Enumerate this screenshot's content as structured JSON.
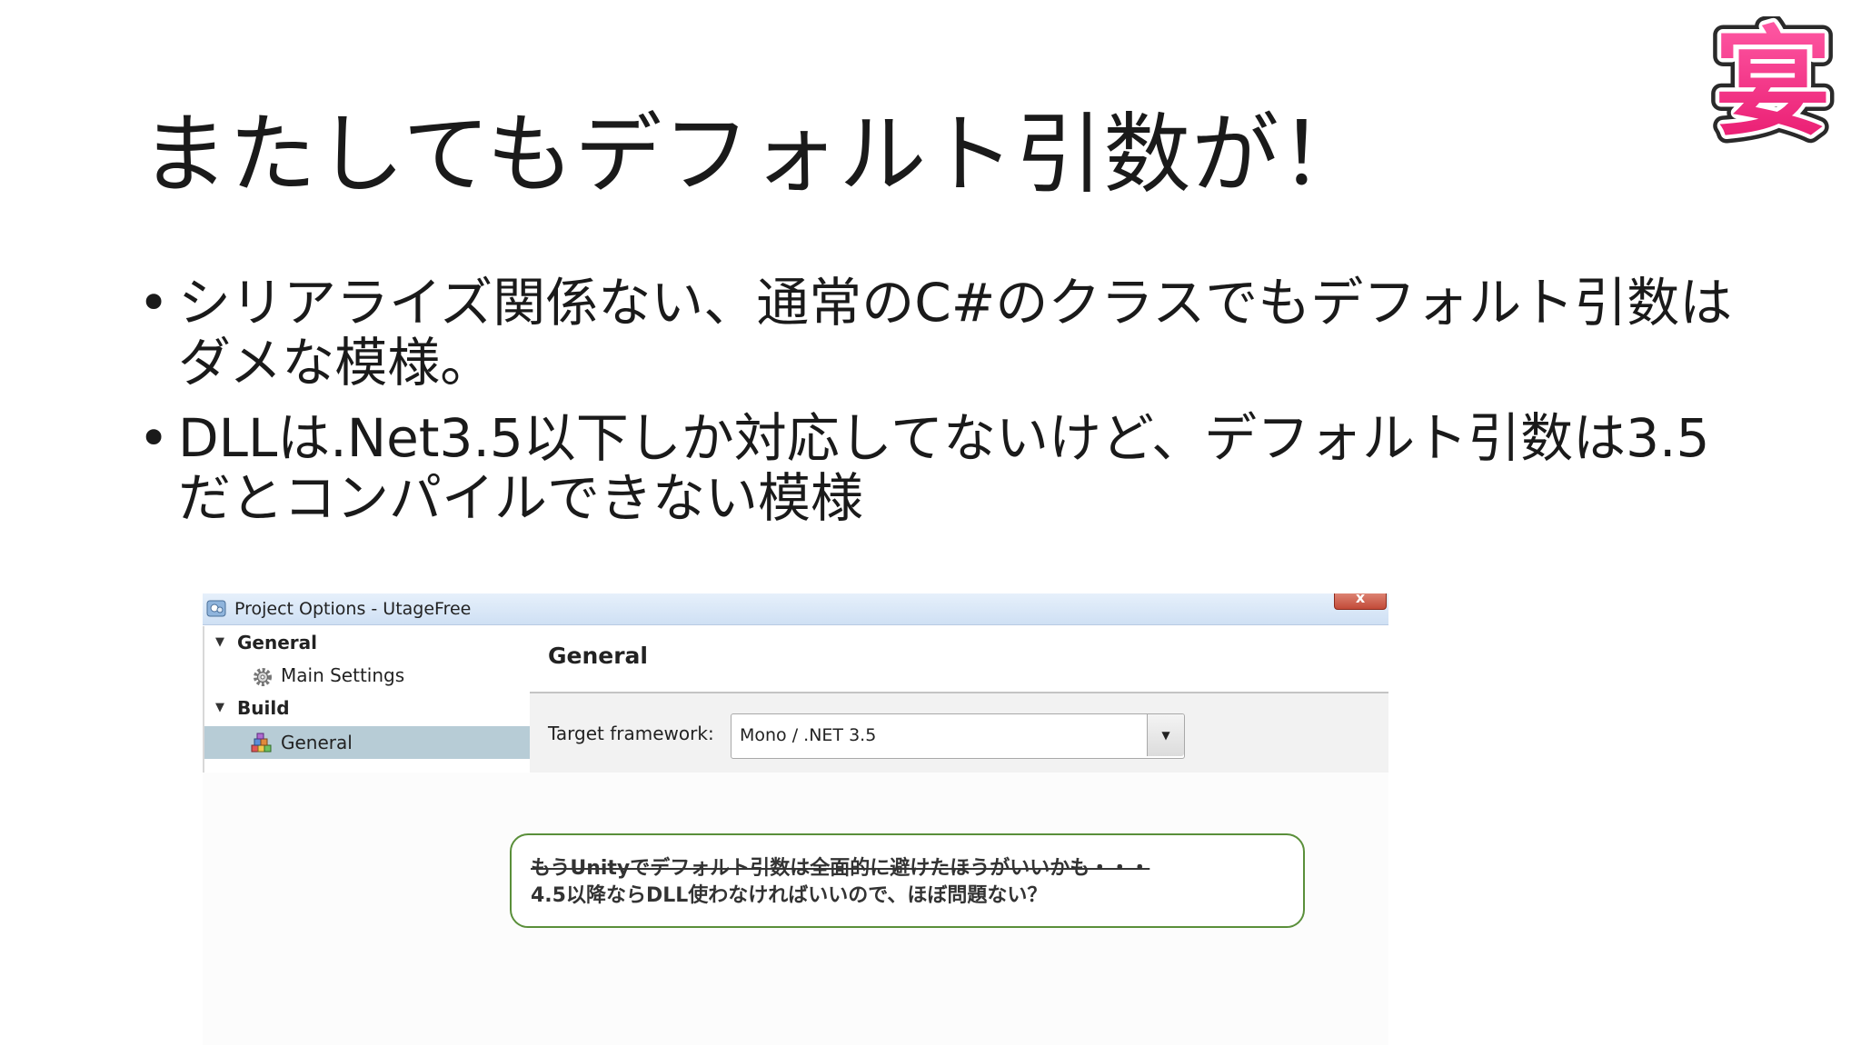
{
  "slide": {
    "title": "またしてもデフォルト引数が！",
    "logo_char": "宴",
    "bullets": [
      "シリアライズ関係ない、通常のC#のクラスでもデフォルト引数はダメな模様。",
      "DLLは.Net3.5以下しか対応してないけど、デフォルト引数は3.5だとコンパイルできない模様"
    ],
    "bullet_glyph": "•"
  },
  "dialog": {
    "title": "Project Options - UtageFree",
    "close_label": "x",
    "tree": [
      {
        "label": "General",
        "level": 0,
        "expanded": true,
        "icon": "triangle-down-icon"
      },
      {
        "label": "Main Settings",
        "level": 1,
        "icon": "gear-icon"
      },
      {
        "label": "Build",
        "level": 0,
        "expanded": true,
        "icon": "triangle-down-icon"
      },
      {
        "label": "General",
        "level": 1,
        "icon": "build-blocks-icon",
        "selected": true
      }
    ],
    "panel_title": "General",
    "target_framework_label": "Target framework:",
    "target_framework_value": "Mono / .NET 3.5",
    "dropdown_glyph": "▼"
  },
  "note": {
    "line1": "もうUnityでデフォルト引数は全面的に避けたほうがいいかも・・・",
    "line1_style": "strikethrough",
    "line2": "4.5以降ならDLL使わなければいいので、ほぼ問題ない？"
  },
  "colors": {
    "logo_fill": "#e8186e",
    "logo_outline": "#2a2a2a",
    "note_border": "#5a8f3a",
    "tree_selected": "#b7ccd6",
    "titlebar": "#d8e6f6"
  }
}
